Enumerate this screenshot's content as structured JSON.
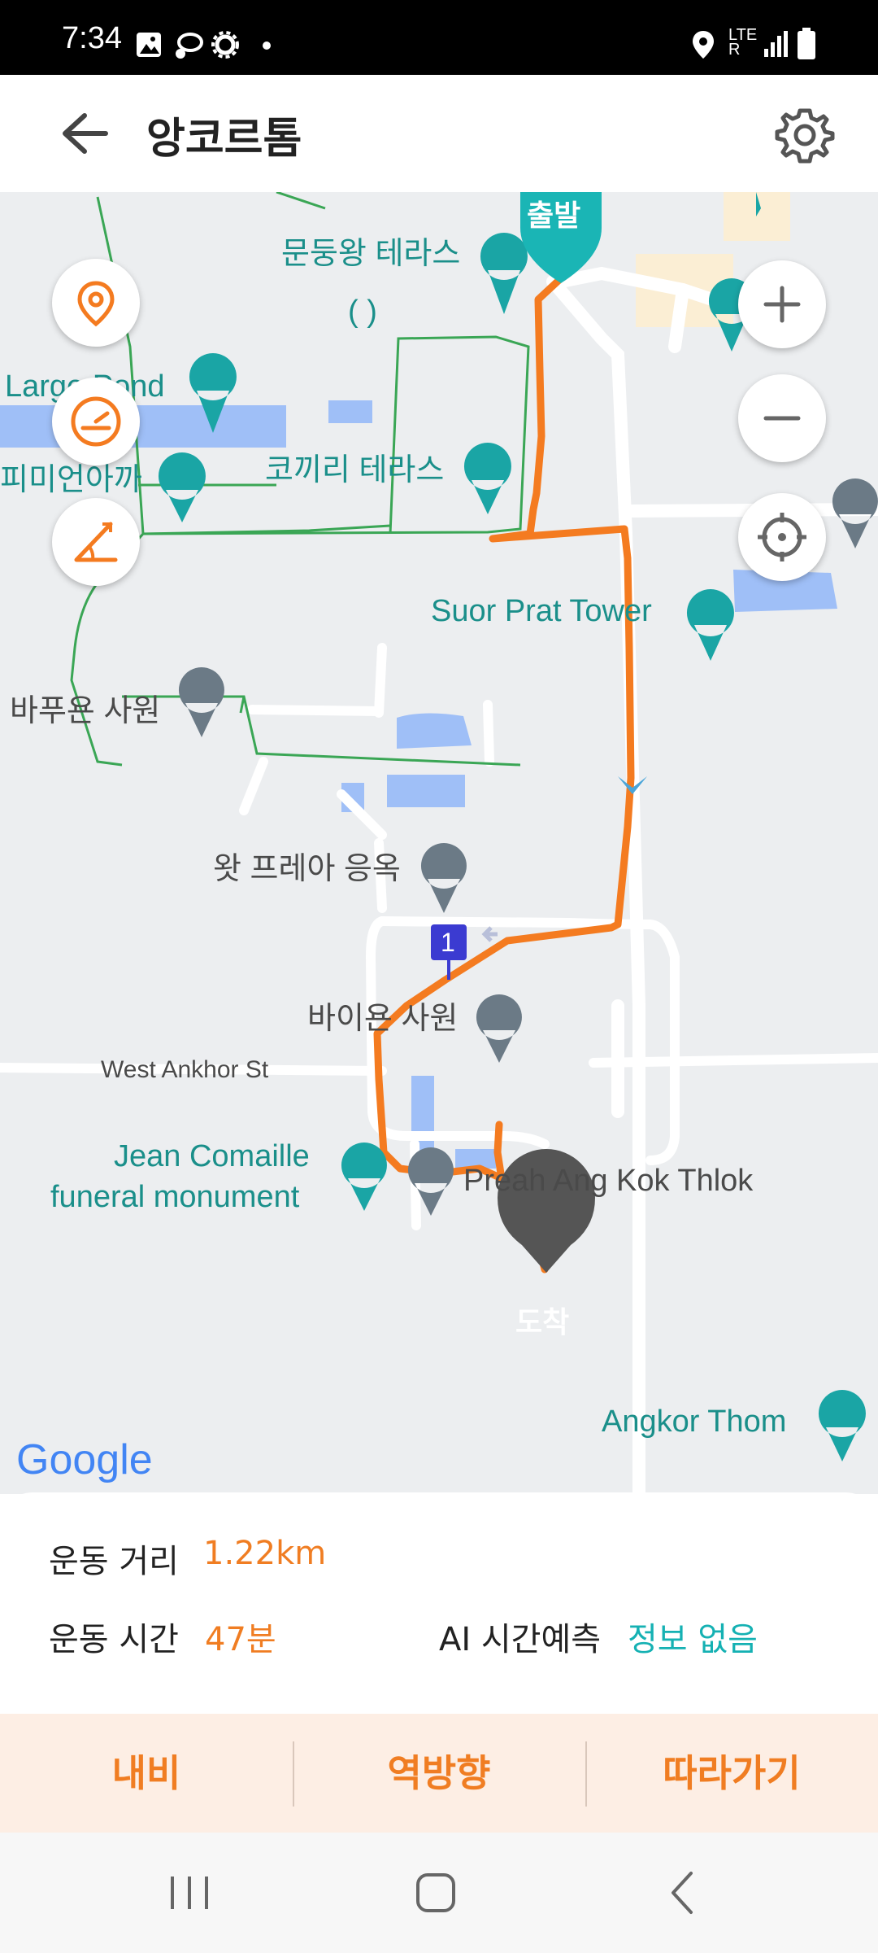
{
  "status_bar": {
    "time": "7:34",
    "network": "LTE R"
  },
  "header": {
    "title": "앙코르톰"
  },
  "map": {
    "labels": {
      "start": "출발",
      "end": "도착",
      "waypoint": "1",
      "terrace_king": "문둥왕 테라스",
      "paren": "(          )",
      "large_pond": "Large Pond",
      "phimeanakas": "피미언아까",
      "elephant_terrace": "코끼리 테라스",
      "suor_prat": "Suor Prat Tower",
      "baphuon": "바푸욘 사원",
      "preah_ngok": "왓 프레아 응옥",
      "bayon": "바이욘 사원",
      "west_ankhor": "West Ankhor St",
      "jean_comaille_1": "Jean Comaille",
      "jean_comaille_2": "funeral monument",
      "preah_ang_kok": "Preah Ang Kok Thlok",
      "angkor_thom": "Angkor Thom",
      "google": "Google"
    },
    "colors": {
      "route": "#f47b20",
      "teal": "#1aa5a5",
      "gray_pin": "#6b7a86",
      "road": "#ffffff",
      "water": "#9fbff7",
      "trail": "#3aa655"
    }
  },
  "stats": {
    "distance_label": "운동 거리",
    "distance_value": "1.22km",
    "time_label": "운동 시간",
    "time_value": "47분",
    "ai_label": "AI 시간예측",
    "ai_value": "정보 없음"
  },
  "actions": {
    "navigate": "내비",
    "reverse": "역방향",
    "follow": "따라가기"
  },
  "icons": [
    "back-arrow-icon",
    "settings-gear-icon",
    "location-pin-icon",
    "speedometer-icon",
    "altitude-icon",
    "zoom-in-icon",
    "zoom-out-icon",
    "my-location-icon",
    "recent-apps-icon",
    "home-icon",
    "back-icon"
  ]
}
